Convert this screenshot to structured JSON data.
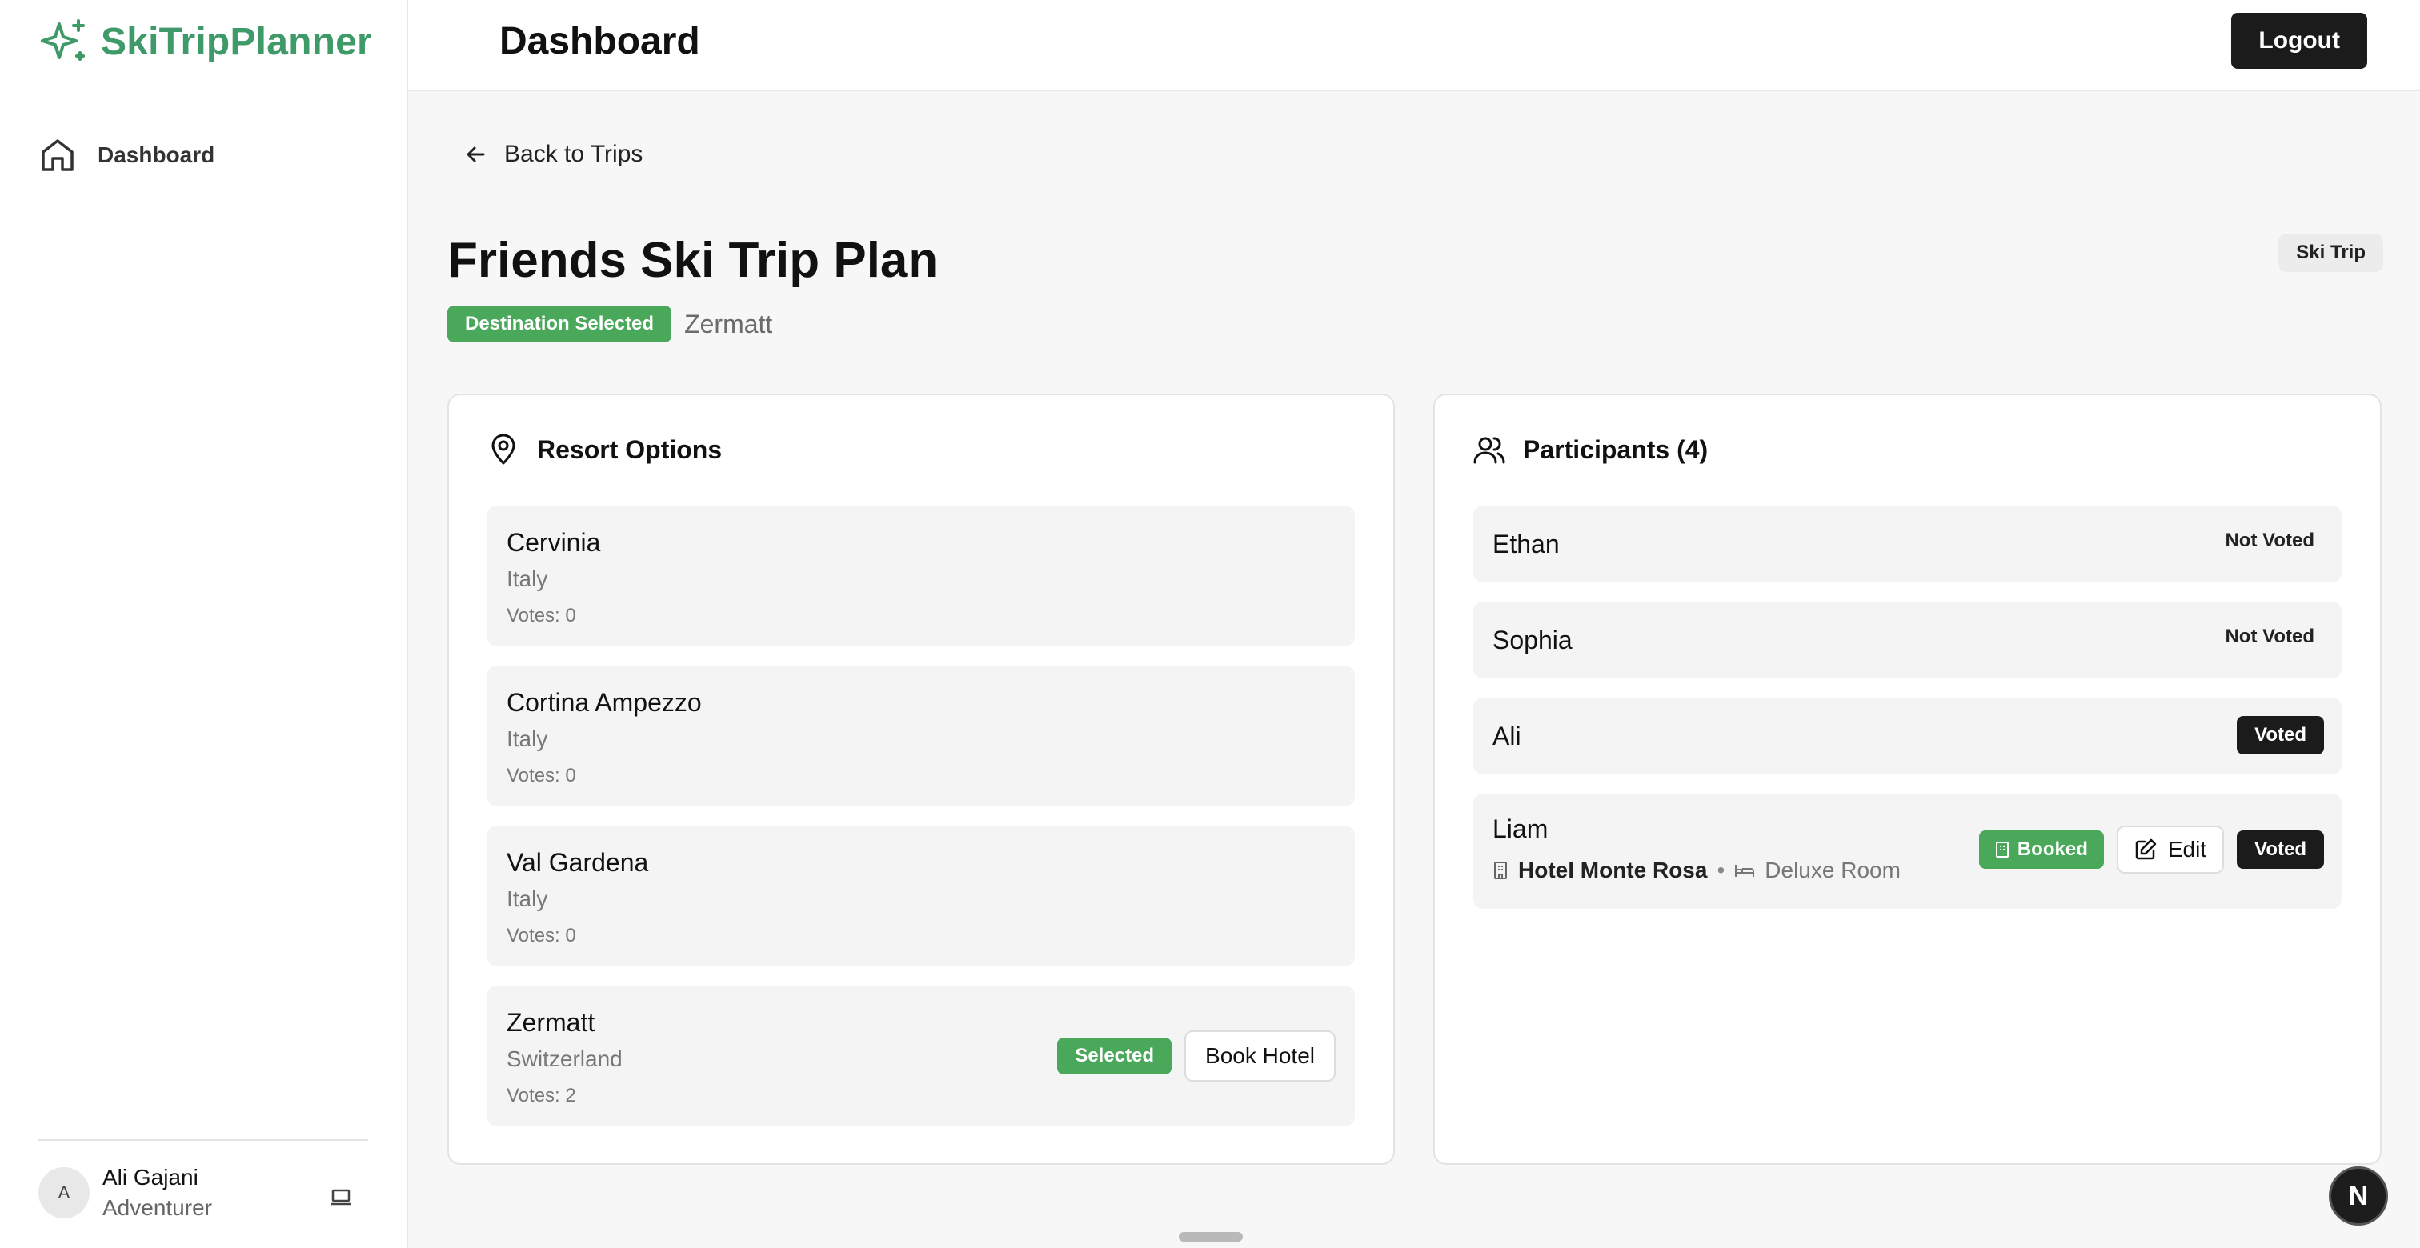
{
  "brand": {
    "name": "SkiTripPlanner",
    "color": "#3e9a68"
  },
  "sidebar": {
    "items": [
      {
        "label": "Dashboard",
        "icon": "home-icon"
      }
    ],
    "user": {
      "initial": "A",
      "name": "Ali Gajani",
      "role": "Adventurer"
    }
  },
  "header": {
    "title": "Dashboard",
    "logout_label": "Logout"
  },
  "trip": {
    "back_label": "Back to Trips",
    "title": "Friends Ski Trip Plan",
    "status_badge": "Destination Selected",
    "destination": "Zermatt",
    "type_tag": "Ski Trip"
  },
  "resorts": {
    "heading": "Resort Options",
    "items": [
      {
        "name": "Cervinia",
        "country": "Italy",
        "votes": "Votes: 0"
      },
      {
        "name": "Cortina Ampezzo",
        "country": "Italy",
        "votes": "Votes: 0"
      },
      {
        "name": "Val Gardena",
        "country": "Italy",
        "votes": "Votes: 0"
      },
      {
        "name": "Zermatt",
        "country": "Switzerland",
        "votes": "Votes: 2",
        "selected_label": "Selected",
        "book_label": "Book Hotel"
      }
    ]
  },
  "participants": {
    "heading": "Participants (4)",
    "items": [
      {
        "name": "Ethan",
        "status": "Not Voted"
      },
      {
        "name": "Sophia",
        "status": "Not Voted"
      },
      {
        "name": "Ali",
        "status": "Voted"
      },
      {
        "name": "Liam",
        "status": "Voted",
        "booked_label": "Booked",
        "edit_label": "Edit",
        "hotel": "Hotel Monte Rosa",
        "separator": "•",
        "room": "Deluxe Room"
      }
    ]
  },
  "dev_badge": "N",
  "colors": {
    "accent_green": "#49a85a",
    "dark": "#1b1b1b",
    "background": "#f7f7f7"
  }
}
